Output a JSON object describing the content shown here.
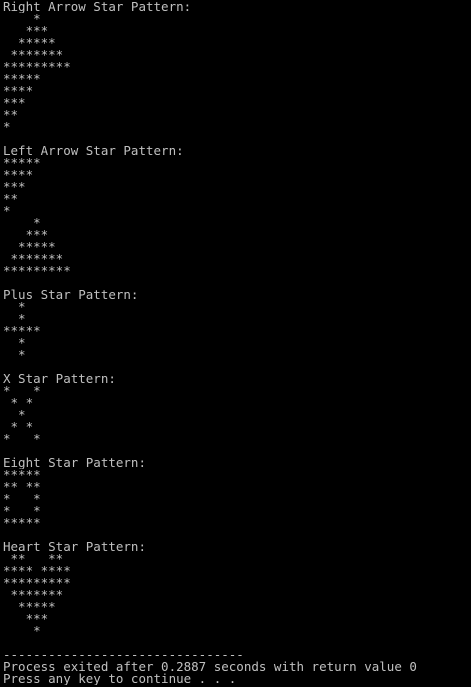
{
  "console": {
    "lines": [
      "Right Arrow Star Pattern:",
      "    *",
      "   ***",
      "  *****",
      " *******",
      "*********",
      "*****",
      "****",
      "***",
      "**",
      "*",
      "",
      "Left Arrow Star Pattern:",
      "*****",
      "****",
      "***",
      "**",
      "*",
      "    *",
      "   ***",
      "  *****",
      " *******",
      "*********",
      "",
      "Plus Star Pattern:",
      "  *",
      "  *",
      "*****",
      "  *",
      "  *",
      "",
      "X Star Pattern:",
      "*   *",
      " * *",
      "  *",
      " * *",
      "*   *",
      "",
      "Eight Star Pattern:",
      "*****",
      "** **",
      "*   *",
      "*   *",
      "*****",
      "",
      "Heart Star Pattern:",
      " **   **",
      "**** ****",
      "*********",
      " *******",
      "  *****",
      "   ***",
      "    *",
      "",
      "--------------------------------",
      "Process exited after 0.2887 seconds with return value 0",
      "Press any key to continue . . ."
    ]
  },
  "colors": {
    "background": "#000000",
    "text": "#c0c0c0"
  }
}
